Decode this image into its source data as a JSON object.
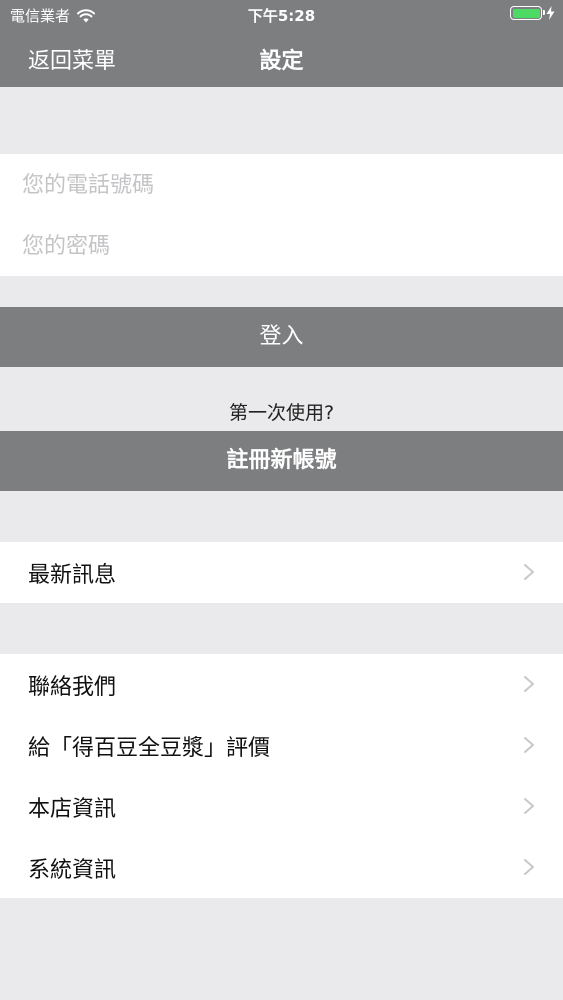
{
  "status_bar": {
    "carrier": "電信業者",
    "time": "下午5:28"
  },
  "nav": {
    "back_label": "返回菜單",
    "title": "設定"
  },
  "login_form": {
    "phone_placeholder": "您的電話號碼",
    "password_placeholder": "您的密碼",
    "login_label": "登入"
  },
  "register": {
    "prompt": "第一次使用?",
    "button_label": "註冊新帳號"
  },
  "menu": {
    "group1": [
      {
        "label": "最新訊息"
      }
    ],
    "group2": [
      {
        "label": "聯絡我們"
      },
      {
        "label": "給「得百豆全豆漿」評價"
      },
      {
        "label": "本店資訊"
      },
      {
        "label": "系統資訊"
      }
    ]
  },
  "colors": {
    "header": "#7d7e80",
    "background": "#eaeaec",
    "battery": "#4cd964"
  }
}
